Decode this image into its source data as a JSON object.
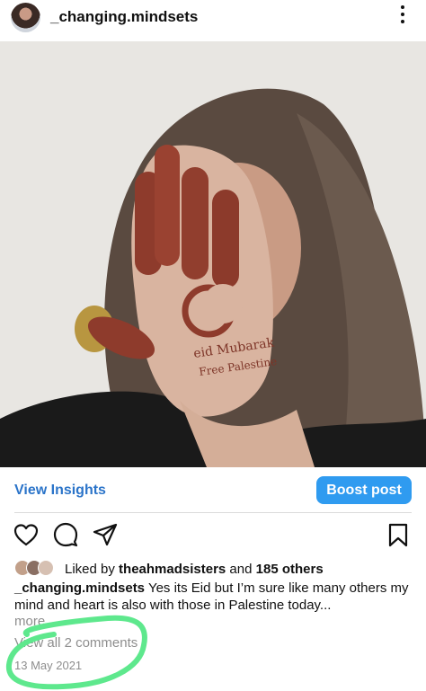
{
  "post": {
    "username": "_changing.mindsets",
    "hand_text_line1": "eid Mubarak",
    "hand_text_line2": "Free Palestine"
  },
  "insights": {
    "view_insights_label": "View Insights",
    "boost_label": "Boost post"
  },
  "actions": {
    "icons": [
      "heart-icon",
      "comment-icon",
      "share-icon",
      "bookmark-icon"
    ]
  },
  "likes": {
    "prefix": "Liked by ",
    "user": "theahmadsisters",
    "middle": " and ",
    "count": "185 others"
  },
  "caption": {
    "username": "_changing.mindsets",
    "text": "Yes its Eid but I’m sure like many others my mind and heart is also with those in Palestine today...",
    "more_label": "more"
  },
  "comments": {
    "view_all_label": "View all 2 comments"
  },
  "date": "13 May 2021",
  "colors": {
    "link_blue": "#2b74c9",
    "button_blue": "#2f9bf0",
    "annotation_green": "#5ee88d"
  }
}
